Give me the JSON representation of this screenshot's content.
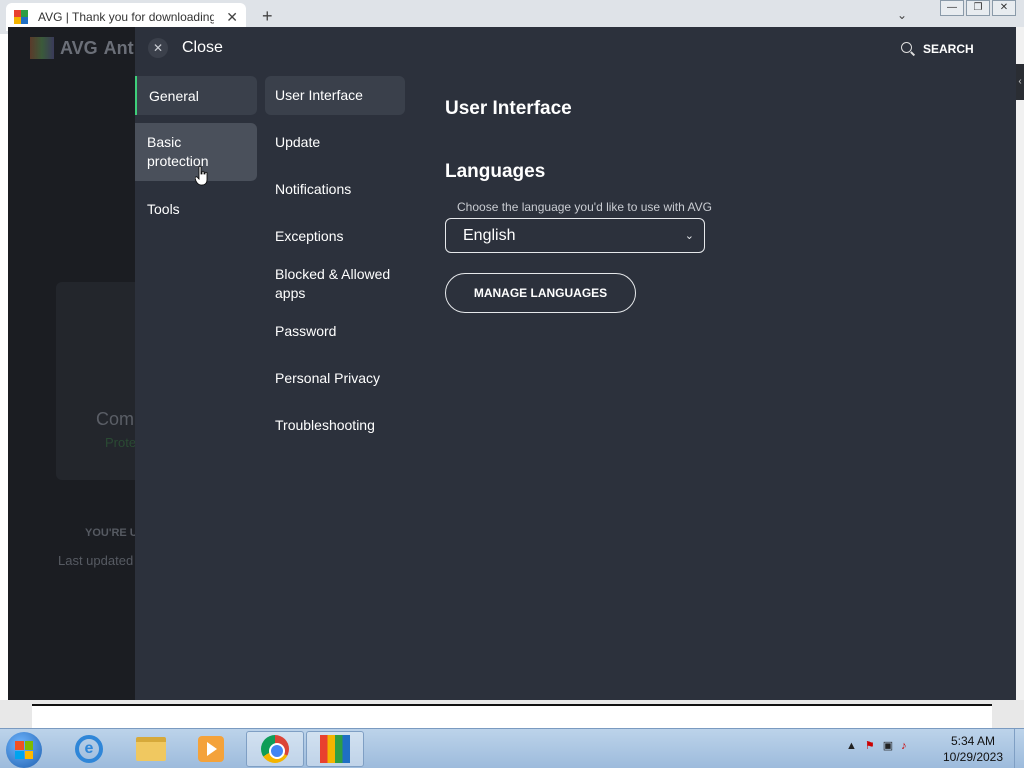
{
  "browser": {
    "tab_title": "AVG | Thank you for downloading",
    "tab_close": "✕",
    "new_tab": "+",
    "tab_dropdown": "⌄",
    "window_controls": [
      "—",
      "❐",
      "✕"
    ]
  },
  "background_app": {
    "logo": "AVG",
    "logo_suffix": "Ant",
    "card_text": "Com",
    "card_sub": "Prote",
    "status": "YOU'RE U",
    "last_updated": "Last updated"
  },
  "settings": {
    "close_label": "Close",
    "search_label": "SEARCH",
    "categories": [
      {
        "label": "General"
      },
      {
        "label": "Basic protection"
      },
      {
        "label": "Tools"
      }
    ],
    "subitems": [
      {
        "label": "User Interface"
      },
      {
        "label": "Update"
      },
      {
        "label": "Notifications"
      },
      {
        "label": "Exceptions"
      },
      {
        "label": "Blocked & Allowed apps"
      },
      {
        "label": "Password"
      },
      {
        "label": "Personal Privacy"
      },
      {
        "label": "Troubleshooting"
      }
    ],
    "content": {
      "title": "User Interface",
      "section_title": "Languages",
      "language_label": "Choose the language you'd like to use with AVG",
      "language_value": "English",
      "manage_button": "MANAGE LANGUAGES"
    },
    "accent_color": "#3ecf7a"
  },
  "taskbar": {
    "apps": [
      "internet-explorer",
      "file-explorer",
      "media-player",
      "chrome",
      "avg"
    ],
    "time": "5:34 AM",
    "date": "10/29/2023"
  }
}
